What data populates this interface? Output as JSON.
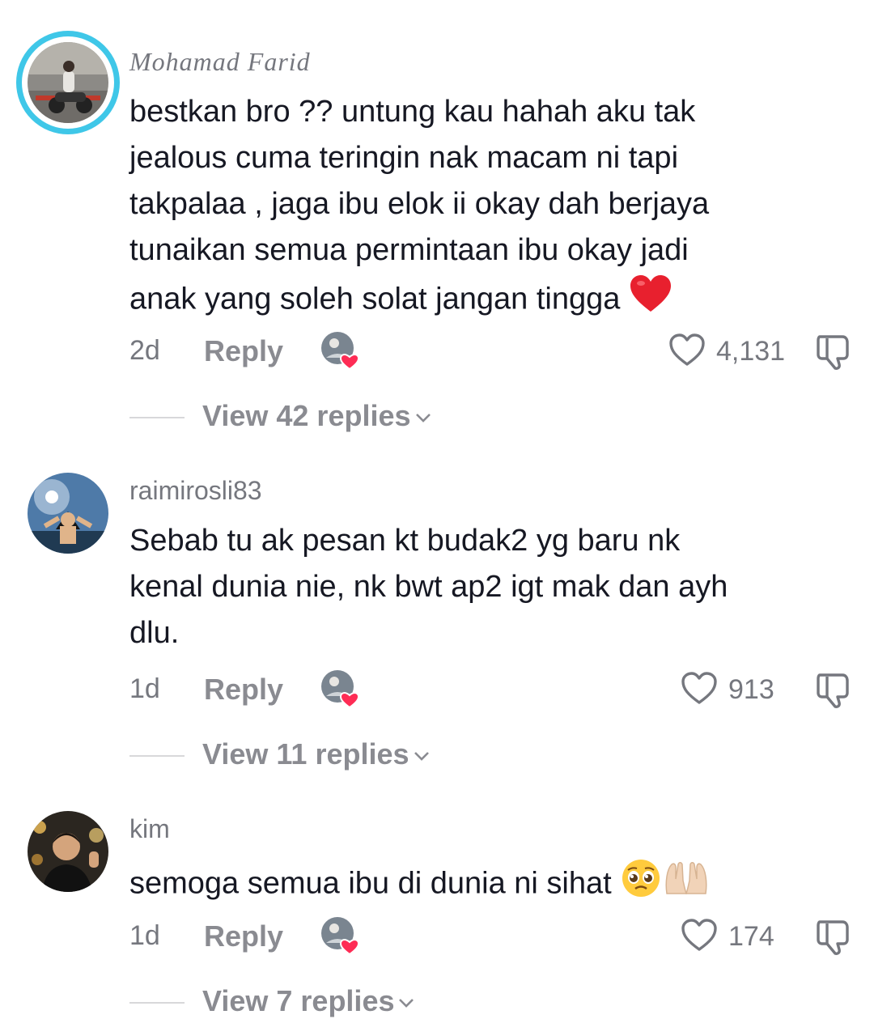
{
  "comments": [
    {
      "username": "Mohamad Farid",
      "lines": [
        "bestkan bro ?? untung kau hahah aku tak",
        "jealous cuma teringin nak macam ni tapi",
        "takpalaa , jaga ibu elok ii okay dah berjaya",
        "tunaikan semua permintaan ibu okay jadi",
        "anak yang soleh solat jangan tingga"
      ],
      "emoji": [
        "red-heart"
      ],
      "time": "2d",
      "reply_label": "Reply",
      "likes": "4,131",
      "view_replies": "View 42 replies"
    },
    {
      "username": "raimirosli83",
      "lines": [
        "Sebab tu ak pesan kt budak2 yg baru nk",
        "kenal dunia nie, nk bwt ap2 igt mak dan ayh",
        "dlu."
      ],
      "emoji": [],
      "time": "1d",
      "reply_label": "Reply",
      "likes": "913",
      "view_replies": "View 11 replies"
    },
    {
      "username": "kim",
      "lines": [
        "semoga semua ibu di dunia ni sihat"
      ],
      "emoji": [
        "pleading-face",
        "palms-up-together"
      ],
      "time": "1d",
      "reply_label": "Reply",
      "likes": "174",
      "view_replies": "View 7 replies"
    }
  ],
  "colors": {
    "accent_ring": "#3fc7e8",
    "like_heart": "#fe2c55",
    "text_primary": "#161823",
    "text_secondary": "#75777e"
  }
}
